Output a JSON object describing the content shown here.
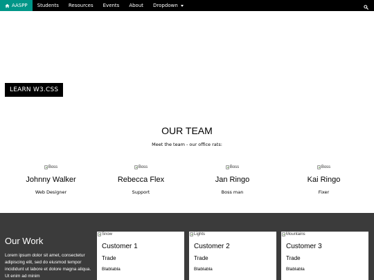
{
  "nav": {
    "home_label": "AASPP",
    "items": [
      "Students",
      "Resources",
      "Events",
      "About"
    ],
    "dropdown_label": "Dropdown",
    "accent_color": "#009688",
    "bar_color": "#000000"
  },
  "hero": {
    "button_label": "LEARN W3.CSS"
  },
  "team": {
    "title": "OUR TEAM",
    "subtitle": "Meet the team - our office rats:",
    "members": [
      {
        "img_alt": "Boss",
        "name": "Johnny Walker",
        "role": "Web Designer"
      },
      {
        "img_alt": "Boss",
        "name": "Rebecca Flex",
        "role": "Support"
      },
      {
        "img_alt": "Boss",
        "name": "Jan Ringo",
        "role": "Boss man"
      },
      {
        "img_alt": "Boss",
        "name": "Kai Ringo",
        "role": "Fixer"
      }
    ]
  },
  "work": {
    "title": "Our Work",
    "text": "Lorem ipsum dolor sit amet, consectetur adipiscing elit, sed do eiusmod tempor incididunt ut labore et dolore magna aliqua. Ut enim ad minim",
    "background_color": "#3b3b3b",
    "cards": [
      {
        "img_alt": "Snow",
        "title": "Customer 1",
        "trade": "Trade",
        "text": "Blablabla"
      },
      {
        "img_alt": "Lights",
        "title": "Customer 2",
        "trade": "Trade",
        "text": "Blablabla"
      },
      {
        "img_alt": "Mountains",
        "title": "Customer 3",
        "trade": "Trade",
        "text": "Blablabla"
      }
    ]
  }
}
